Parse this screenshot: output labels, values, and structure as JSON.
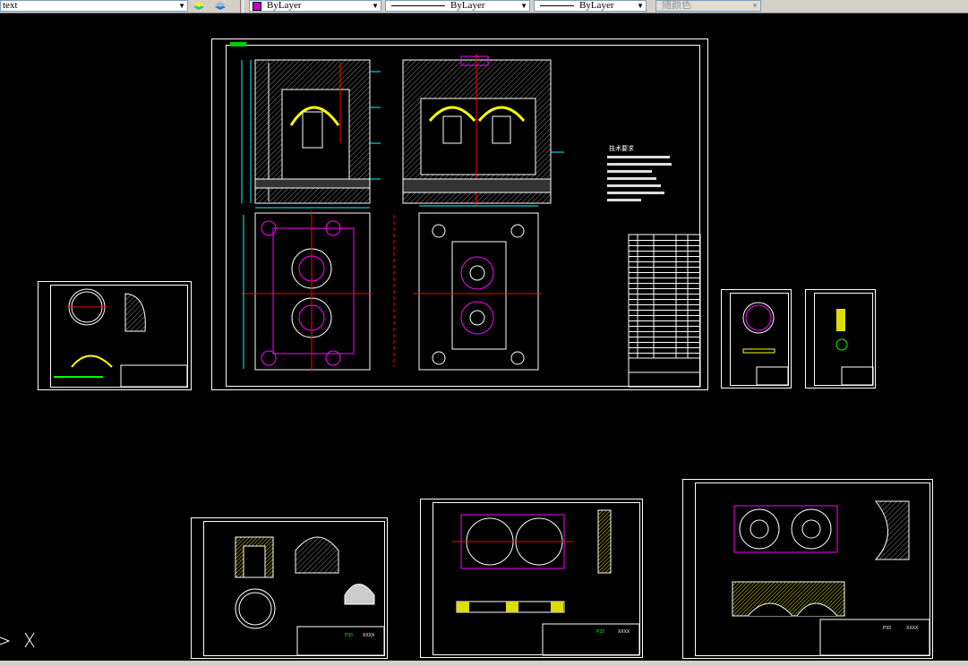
{
  "toolbar": {
    "text_style": "text",
    "layer_color": "ByLayer",
    "linetype": "ByLayer",
    "lineweight": "ByLayer",
    "plot_style": "随颜色",
    "layer_color_swatch": "#c000c0",
    "icons": [
      "layer-states-icon",
      "layer-previous-icon"
    ]
  },
  "drawing": {
    "background": "#000000",
    "main_sheet": {
      "notes_title": "技术要求",
      "notes": [
        "1.",
        "2.",
        "3."
      ]
    },
    "title_blocks": [
      {
        "part": "P33",
        "name": "XXXX"
      },
      {
        "part": "P33",
        "name": "XXXX"
      },
      {
        "part": "P33",
        "name": "XXXX"
      }
    ]
  },
  "colors": {
    "cyan": "#00ffff",
    "magenta": "#ff00ff",
    "yellow": "#ffff00",
    "green": "#00ff00",
    "red": "#ff0000",
    "white": "#ffffff"
  }
}
